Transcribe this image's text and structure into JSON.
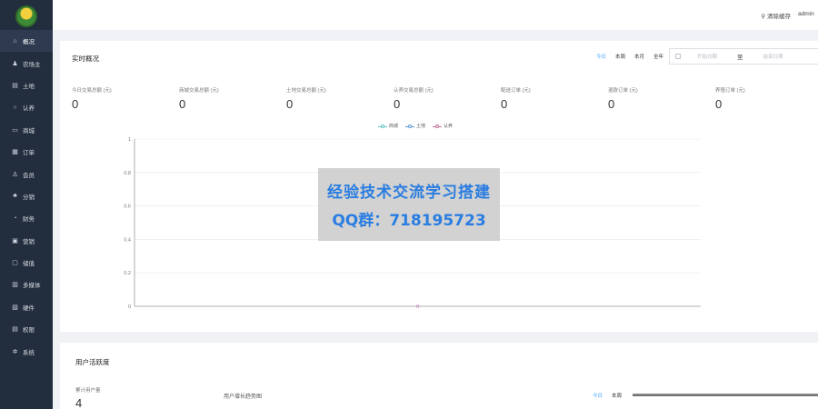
{
  "sidebar": {
    "items": [
      {
        "label": "概况",
        "icon": "home-icon",
        "glyph": "⌂"
      },
      {
        "label": "农场主",
        "icon": "user-icon",
        "glyph": "♟"
      },
      {
        "label": "土地",
        "icon": "land-icon",
        "glyph": "▤"
      },
      {
        "label": "认养",
        "icon": "adopt-icon",
        "glyph": "○"
      },
      {
        "label": "商城",
        "icon": "shop-icon",
        "glyph": "▭"
      },
      {
        "label": "订单",
        "icon": "order-icon",
        "glyph": "▦"
      },
      {
        "label": "会员",
        "icon": "member-icon",
        "glyph": "♙"
      },
      {
        "label": "分销",
        "icon": "distribution-icon",
        "glyph": "♣"
      },
      {
        "label": "财务",
        "icon": "finance-icon",
        "glyph": "◔"
      },
      {
        "label": "营销",
        "icon": "marketing-icon",
        "glyph": "▣"
      },
      {
        "label": "储值",
        "icon": "wallet-icon",
        "glyph": "▢"
      },
      {
        "label": "多媒体",
        "icon": "media-icon",
        "glyph": "▥"
      },
      {
        "label": "硬件",
        "icon": "hardware-icon",
        "glyph": "▧"
      },
      {
        "label": "权限",
        "icon": "permission-icon",
        "glyph": "▤"
      },
      {
        "label": "系统",
        "icon": "settings-icon",
        "glyph": "✲"
      }
    ]
  },
  "topbar": {
    "clear_cache": "清除缓存",
    "user": "admin"
  },
  "overview": {
    "title": "实时概况",
    "tabs": [
      "今日",
      "本周",
      "本月",
      "全年"
    ],
    "date_start_placeholder": "开始日期",
    "date_sep": "至",
    "date_end_placeholder": "结束日期",
    "stats": [
      {
        "label": "今日交易总额 (元)",
        "value": "0"
      },
      {
        "label": "商城交易总额 (元)",
        "value": "0"
      },
      {
        "label": "土地交易总额 (元)",
        "value": "0"
      },
      {
        "label": "认养交易总额 (元)",
        "value": "0"
      },
      {
        "label": "配送订单 (元)",
        "value": "0"
      },
      {
        "label": "退款订单 (元)",
        "value": "0"
      },
      {
        "label": "养殖订单 (元)",
        "value": "0"
      }
    ]
  },
  "watermark": {
    "line1": "经验技术交流学习搭建",
    "line2": "QQ群：718195723"
  },
  "active_users": {
    "title": "用户活跃度",
    "stat_label": "累计用户量",
    "stat_value": "4",
    "chart_title": "用户增长趋势图",
    "tabs": [
      "今日",
      "本周"
    ]
  },
  "chart_data": {
    "type": "line",
    "x": [
      ""
    ],
    "series": [
      {
        "name": "商城",
        "values": [
          0
        ],
        "color": "#5ec4c4"
      },
      {
        "name": "土地",
        "values": [
          0
        ],
        "color": "#5a9bd5"
      },
      {
        "name": "认养",
        "values": [
          0
        ],
        "color": "#c06c9c"
      }
    ],
    "ylim": [
      0,
      1
    ],
    "yticks": [
      "0",
      "0.2",
      "0.4",
      "0.6",
      "0.8",
      "1"
    ],
    "grid": true,
    "legend": "top-center"
  }
}
